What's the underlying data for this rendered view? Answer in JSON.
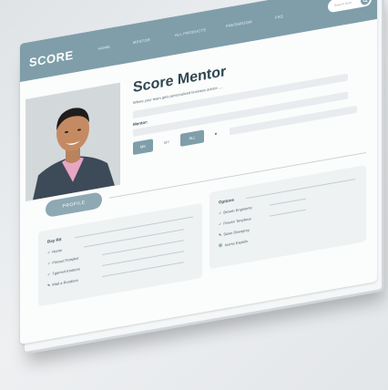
{
  "nav": {
    "logo": "SCORE",
    "items": [
      "HOME",
      "MENTOR",
      "ALL PRODUCTS",
      "PRESSROOM",
      "FAQ"
    ],
    "search_placeholder": "Search here"
  },
  "mentor": {
    "title": "Score Mentor",
    "subtitle": "Where your team gets personalized business advice .....",
    "mentor_label": "Mentor:"
  },
  "tabs": [
    "ME",
    "MY",
    "ALL",
    "■"
  ],
  "profile_button": "PROFILE",
  "left_card": {
    "title": "Bay Rit",
    "items": [
      "Home",
      "Pinnacl Tempkct",
      "Tgamsrt Enotens",
      "Mad a Rundoon"
    ]
  },
  "right_card": {
    "title": "Options",
    "items": [
      "Brewin Engineme",
      "Praven Tenplwus",
      "Sown Deenprey",
      "Iovrss Expaiin"
    ]
  },
  "colors": {
    "nav": "#7f9eaa",
    "accent": "#8ea9b3",
    "title": "#2f4753"
  }
}
